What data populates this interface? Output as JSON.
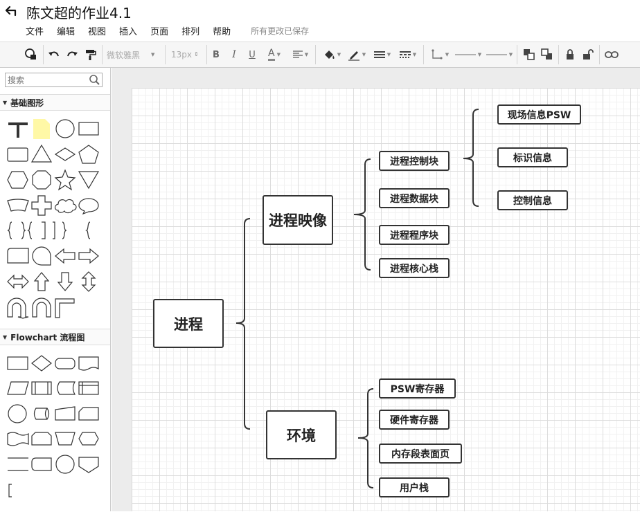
{
  "header": {
    "title": "陈文超的作业4.1",
    "menu": [
      "文件",
      "编辑",
      "视图",
      "插入",
      "页面",
      "排列",
      "帮助"
    ],
    "save_status": "所有更改已保存"
  },
  "toolbar": {
    "font_family": "微软雅黑",
    "font_size": "13px",
    "bold_label": "B",
    "italic_label": "I",
    "underline_label": "U",
    "font_color_label": "A",
    "icons": [
      "format-icon",
      "undo-icon",
      "redo-icon",
      "paint-format-icon",
      "fill-color-icon",
      "line-color-icon",
      "line-width-icon",
      "line-style-icon",
      "connector-icon",
      "start-arrow-icon",
      "end-arrow-icon",
      "bring-front-icon",
      "send-back-icon",
      "lock-icon",
      "unlock-icon",
      "link-icon"
    ]
  },
  "sidebar": {
    "search_placeholder": "搜索",
    "sections": [
      {
        "title": "基础图形"
      },
      {
        "title": "Flowchart 流程图"
      }
    ]
  },
  "diagram": {
    "root": "进程",
    "branches": [
      {
        "label": "进程映像",
        "children": [
          {
            "label": "进程控制块",
            "children": [
              "现场信息PSW",
              "标识信息",
              "控制信息"
            ]
          },
          {
            "label": "进程数据块"
          },
          {
            "label": "进程程序块"
          },
          {
            "label": "进程核心栈"
          }
        ]
      },
      {
        "label": "环境",
        "children": [
          {
            "label": "PSW寄存器"
          },
          {
            "label": "硬件寄存器"
          },
          {
            "label": "内存段表面页"
          },
          {
            "label": "用户栈"
          }
        ]
      }
    ]
  },
  "colors": {
    "node_border": "#333333",
    "sticky_note": "#fff8a6",
    "toolbar_bg": "#f6f6f6",
    "canvas_bg": "#ececec"
  }
}
